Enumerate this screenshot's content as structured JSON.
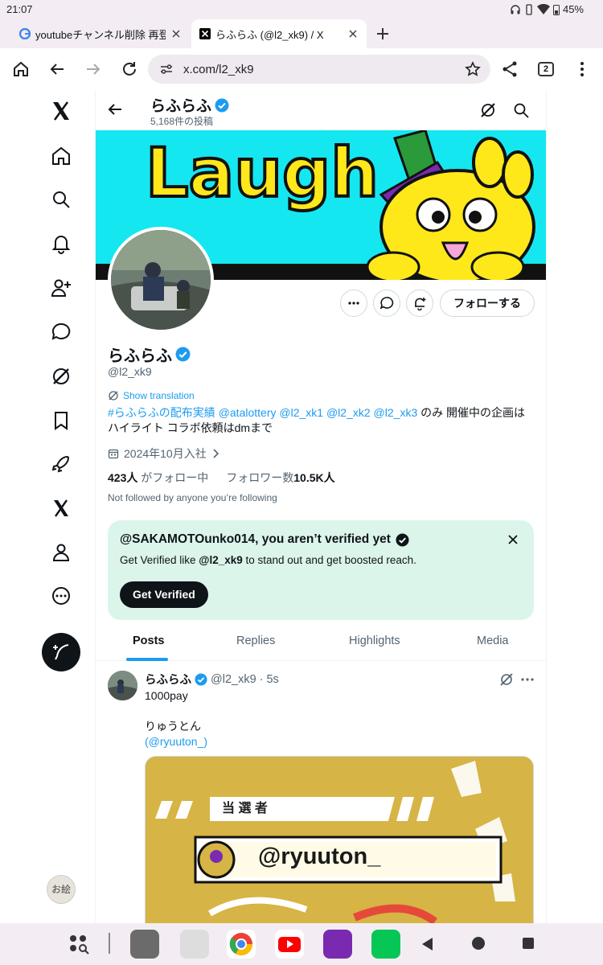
{
  "status": {
    "time": "21:07",
    "battery": "45%"
  },
  "browser": {
    "tabs": [
      {
        "title": "youtubeチャンネル削除 再登録"
      },
      {
        "title": "らふらふ (@l2_xk9) / X"
      }
    ],
    "url": "x.com/l2_xk9",
    "tab_count": "2"
  },
  "profile_header": {
    "name": "らふらふ",
    "post_count": "5,168件の投稿"
  },
  "banner": {
    "text": "Laugh"
  },
  "profile": {
    "follow_label": "フォローする",
    "name": "らふらふ",
    "handle": "@l2_xk9",
    "show_translation": "Show translation",
    "bio": {
      "hashtag": "#らふらふの配布実績",
      "m1": "@atalottery",
      "m2": "@l2_xk1",
      "m3": "@l2_xk2",
      "m4": "@l2_xk3",
      "rest1": " のみ 開催中の企画は",
      "line2": "ハイライト コラボ依頼はdmまで"
    },
    "joined": "2024年10月入社",
    "following_count": "423人",
    "following_label": " がフォロー中",
    "followers_label": "フォロワー数",
    "followers_count": "10.5K人",
    "not_followed": "Not followed by anyone you’re following"
  },
  "verify": {
    "title": "@SAKAMOTOunko014, you aren’t verified yet",
    "sub_pre": "Get Verified like ",
    "sub_handle": "@l2_xk9",
    "sub_post": " to stand out and get boosted reach.",
    "button": "Get Verified"
  },
  "profile_tabs": [
    "Posts",
    "Replies",
    "Highlights",
    "Media"
  ],
  "tweet": {
    "name": "らふらふ",
    "handle": "@l2_xk9",
    "time": "· 5s",
    "line1": "1000pay",
    "line2": "りゅうとん",
    "mention": "(@ryuuton_)",
    "image_label": "当 選 者",
    "image_winner": "@ryuuton_"
  },
  "me_avatar_text": "お絵"
}
